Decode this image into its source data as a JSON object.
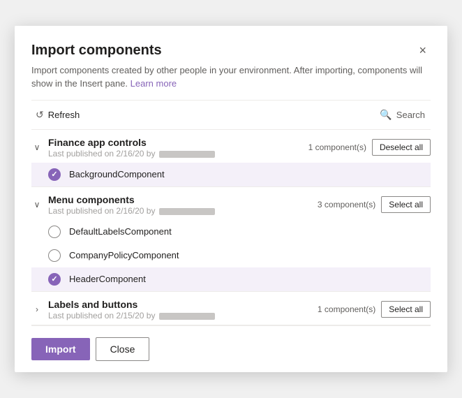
{
  "dialog": {
    "title": "Import components",
    "description": "Import components created by other people in your environment. After importing, components will show in the Insert pane.",
    "learn_more_label": "Learn more",
    "close_label": "×"
  },
  "toolbar": {
    "refresh_label": "Refresh",
    "search_label": "Search"
  },
  "groups": [
    {
      "id": "finance",
      "name": "Finance app controls",
      "meta_prefix": "Last published on 2/16/20 by",
      "component_count": "1 component(s)",
      "action_label": "Deselect all",
      "action_type": "deselect",
      "expanded": true,
      "components": [
        {
          "name": "BackgroundComponent",
          "selected": true
        }
      ]
    },
    {
      "id": "menu",
      "name": "Menu components",
      "meta_prefix": "Last published on 2/16/20 by",
      "component_count": "3 component(s)",
      "action_label": "Select all",
      "action_type": "select",
      "expanded": true,
      "components": [
        {
          "name": "DefaultLabelsComponent",
          "selected": false
        },
        {
          "name": "CompanyPolicyComponent",
          "selected": false
        },
        {
          "name": "HeaderComponent",
          "selected": true
        }
      ]
    },
    {
      "id": "labels",
      "name": "Labels and buttons",
      "meta_prefix": "Last published on 2/15/20 by",
      "component_count": "1 component(s)",
      "action_label": "Select all",
      "action_type": "select",
      "expanded": false,
      "components": []
    }
  ],
  "footer": {
    "import_label": "Import",
    "close_label": "Close"
  }
}
